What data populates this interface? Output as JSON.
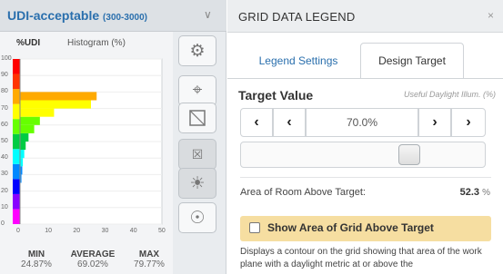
{
  "left_panel": {
    "title": "UDI-acceptable",
    "title_range": "(300-3000)",
    "ylabel": "%UDI",
    "xlabel": "Histogram (%)",
    "stats": [
      {
        "key": "MIN",
        "value": "24.87%"
      },
      {
        "key": "AVERAGE",
        "value": "69.02%"
      },
      {
        "key": "MAX",
        "value": "79.77%"
      }
    ],
    "tools": [
      "gear-icon",
      "crosshair-icon",
      "window-frame-icon",
      "mark-x-icon",
      "sun-icon",
      "zoom-fit-icon"
    ]
  },
  "chart_data": {
    "type": "bar",
    "orientation": "horizontal",
    "ylabel": "%UDI",
    "xlabel": "Histogram (%)",
    "y_ticks": [
      0,
      10,
      20,
      30,
      40,
      50,
      60,
      70,
      80,
      90,
      100
    ],
    "x_ticks": [
      0,
      10,
      20,
      30,
      40,
      50
    ],
    "ylim": [
      0,
      100
    ],
    "xlim": [
      0,
      50
    ],
    "bins": [
      {
        "y0": 25,
        "y1": 30,
        "value": 0.5
      },
      {
        "y0": 30,
        "y1": 35,
        "value": 0.8
      },
      {
        "y0": 35,
        "y1": 40,
        "value": 1
      },
      {
        "y0": 40,
        "y1": 45,
        "value": 1.5
      },
      {
        "y0": 45,
        "y1": 50,
        "value": 2
      },
      {
        "y0": 50,
        "y1": 55,
        "value": 3
      },
      {
        "y0": 55,
        "y1": 60,
        "value": 5
      },
      {
        "y0": 60,
        "y1": 65,
        "value": 7
      },
      {
        "y0": 65,
        "y1": 70,
        "value": 12
      },
      {
        "y0": 70,
        "y1": 75,
        "value": 25
      },
      {
        "y0": 75,
        "y1": 80,
        "value": 27
      }
    ],
    "colorscale": [
      "#ff00ff",
      "#8800ff",
      "#0000ff",
      "#0088ff",
      "#00ffff",
      "#00cc44",
      "#66ff00",
      "#ffff00",
      "#ffaa00",
      "#ff3300",
      "#ff0000"
    ]
  },
  "right_panel": {
    "title": "GRID DATA LEGEND",
    "close_glyph": "×",
    "tabs": [
      "Legend Settings",
      "Design Target"
    ],
    "target_label": "Target Value",
    "target_sub": "Useful Daylight Illum. (%)",
    "buttons": {
      "b1": "‹",
      "b2": "‹",
      "b3": "›",
      "b4": "›"
    },
    "target_value": "70.0%",
    "slider_fraction": 0.7,
    "area_label": "Area of Room Above Target:",
    "area_value": "52.3",
    "area_unit": "%",
    "show_label": "Show Area of Grid Above Target",
    "description": "Displays a contour on the grid showing that area of the work plane with a daylight metric at or above the"
  }
}
